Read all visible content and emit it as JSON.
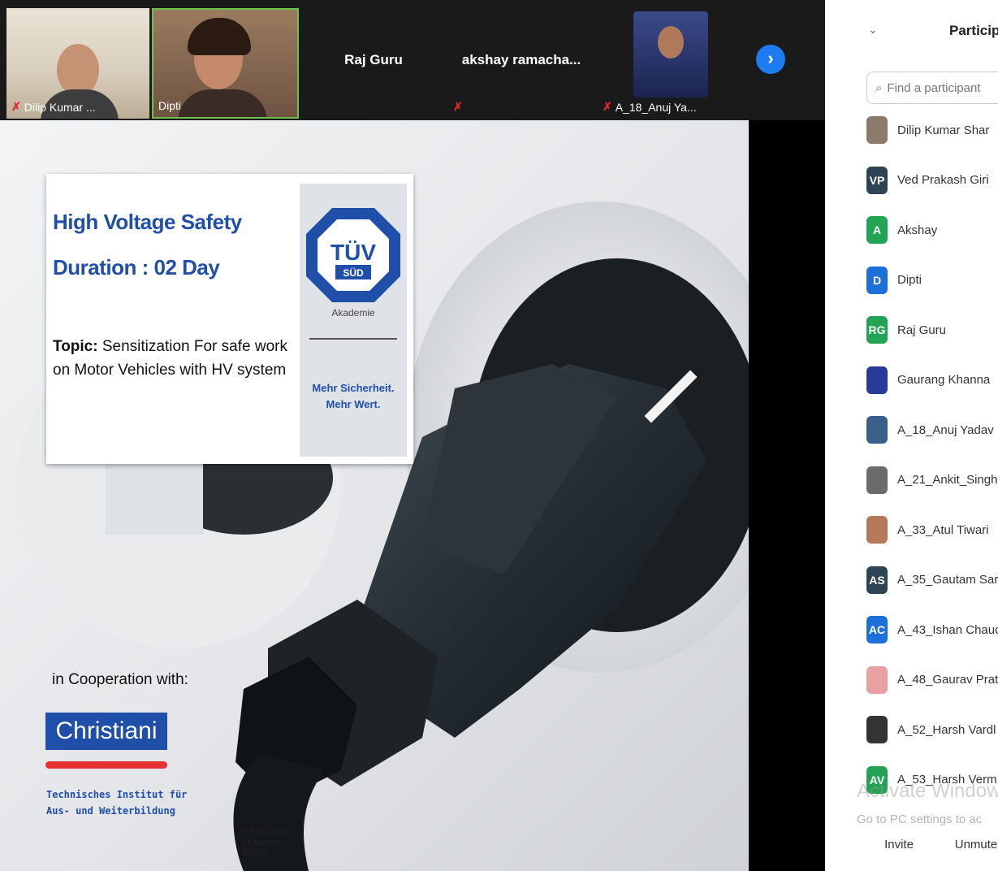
{
  "video_strip": {
    "tiles": [
      {
        "name": "Dilip Kumar ...",
        "muted": true
      },
      {
        "name": "Dipti",
        "muted": false
      },
      {
        "name": "Raj Guru",
        "muted": false
      },
      {
        "name": "akshay  ramacha...",
        "muted": true
      },
      {
        "name": "A_18_Anuj Ya...",
        "muted": true
      }
    ],
    "next_icon": "chevron-right-icon"
  },
  "slide": {
    "title": "High Voltage Safety",
    "duration": "Duration : 02 Day",
    "topic_label": "Topic:",
    "topic_text": " Sensitization For safe work on Motor Vehicles with HV system",
    "tuv_logo_text": "TÜV",
    "tuv_logo_sub": "SÜD",
    "akademie": "Akademie",
    "motto_1": "Mehr Sicherheit.",
    "motto_2": "Mehr Wert.",
    "cooperation": "in Cooperation with:",
    "partner": "Christiani",
    "partner_line_1": "Technisches Institut für",
    "partner_line_2": "Aus- und Weiterbildung",
    "copyright": "© TÜV SÜD Akademie GmbH"
  },
  "participants": {
    "title": "Particip",
    "search_placeholder": "Find a participant",
    "list": [
      {
        "name": "Dilip Kumar Shar",
        "initials": "",
        "color": "#8a7b6b"
      },
      {
        "name": "Ved Prakash Giri",
        "initials": "VP",
        "color": "#2f4356"
      },
      {
        "name": "Akshay",
        "initials": "A",
        "color": "#23a455"
      },
      {
        "name": "Dipti",
        "initials": "D",
        "color": "#1e6fd9"
      },
      {
        "name": "Raj Guru",
        "initials": "RG",
        "color": "#23a455"
      },
      {
        "name": "Gaurang Khanna",
        "initials": "",
        "color": "#2a3a9a"
      },
      {
        "name": "A_18_Anuj Yadav",
        "initials": "",
        "color": "#3a5f8a"
      },
      {
        "name": "A_21_Ankit_Singh",
        "initials": "",
        "color": "#6b6b6b"
      },
      {
        "name": "A_33_Atul Tiwari",
        "initials": "",
        "color": "#b57a5a"
      },
      {
        "name": "A_35_Gautam Sar",
        "initials": "AS",
        "color": "#2f4356"
      },
      {
        "name": "A_43_Ishan Chauc",
        "initials": "AC",
        "color": "#1e6fd9"
      },
      {
        "name": "A_48_Gaurav Prat",
        "initials": "",
        "color": "#e8a0a0"
      },
      {
        "name": "A_52_Harsh Vardl",
        "initials": "",
        "color": "#333333"
      },
      {
        "name": "A_53_Harsh Verm",
        "initials": "AV",
        "color": "#23a455"
      }
    ],
    "watermark_1": "Activate Window",
    "watermark_2": "Go to PC settings to ac",
    "invite": "Invite",
    "unmute": "Unmute"
  }
}
